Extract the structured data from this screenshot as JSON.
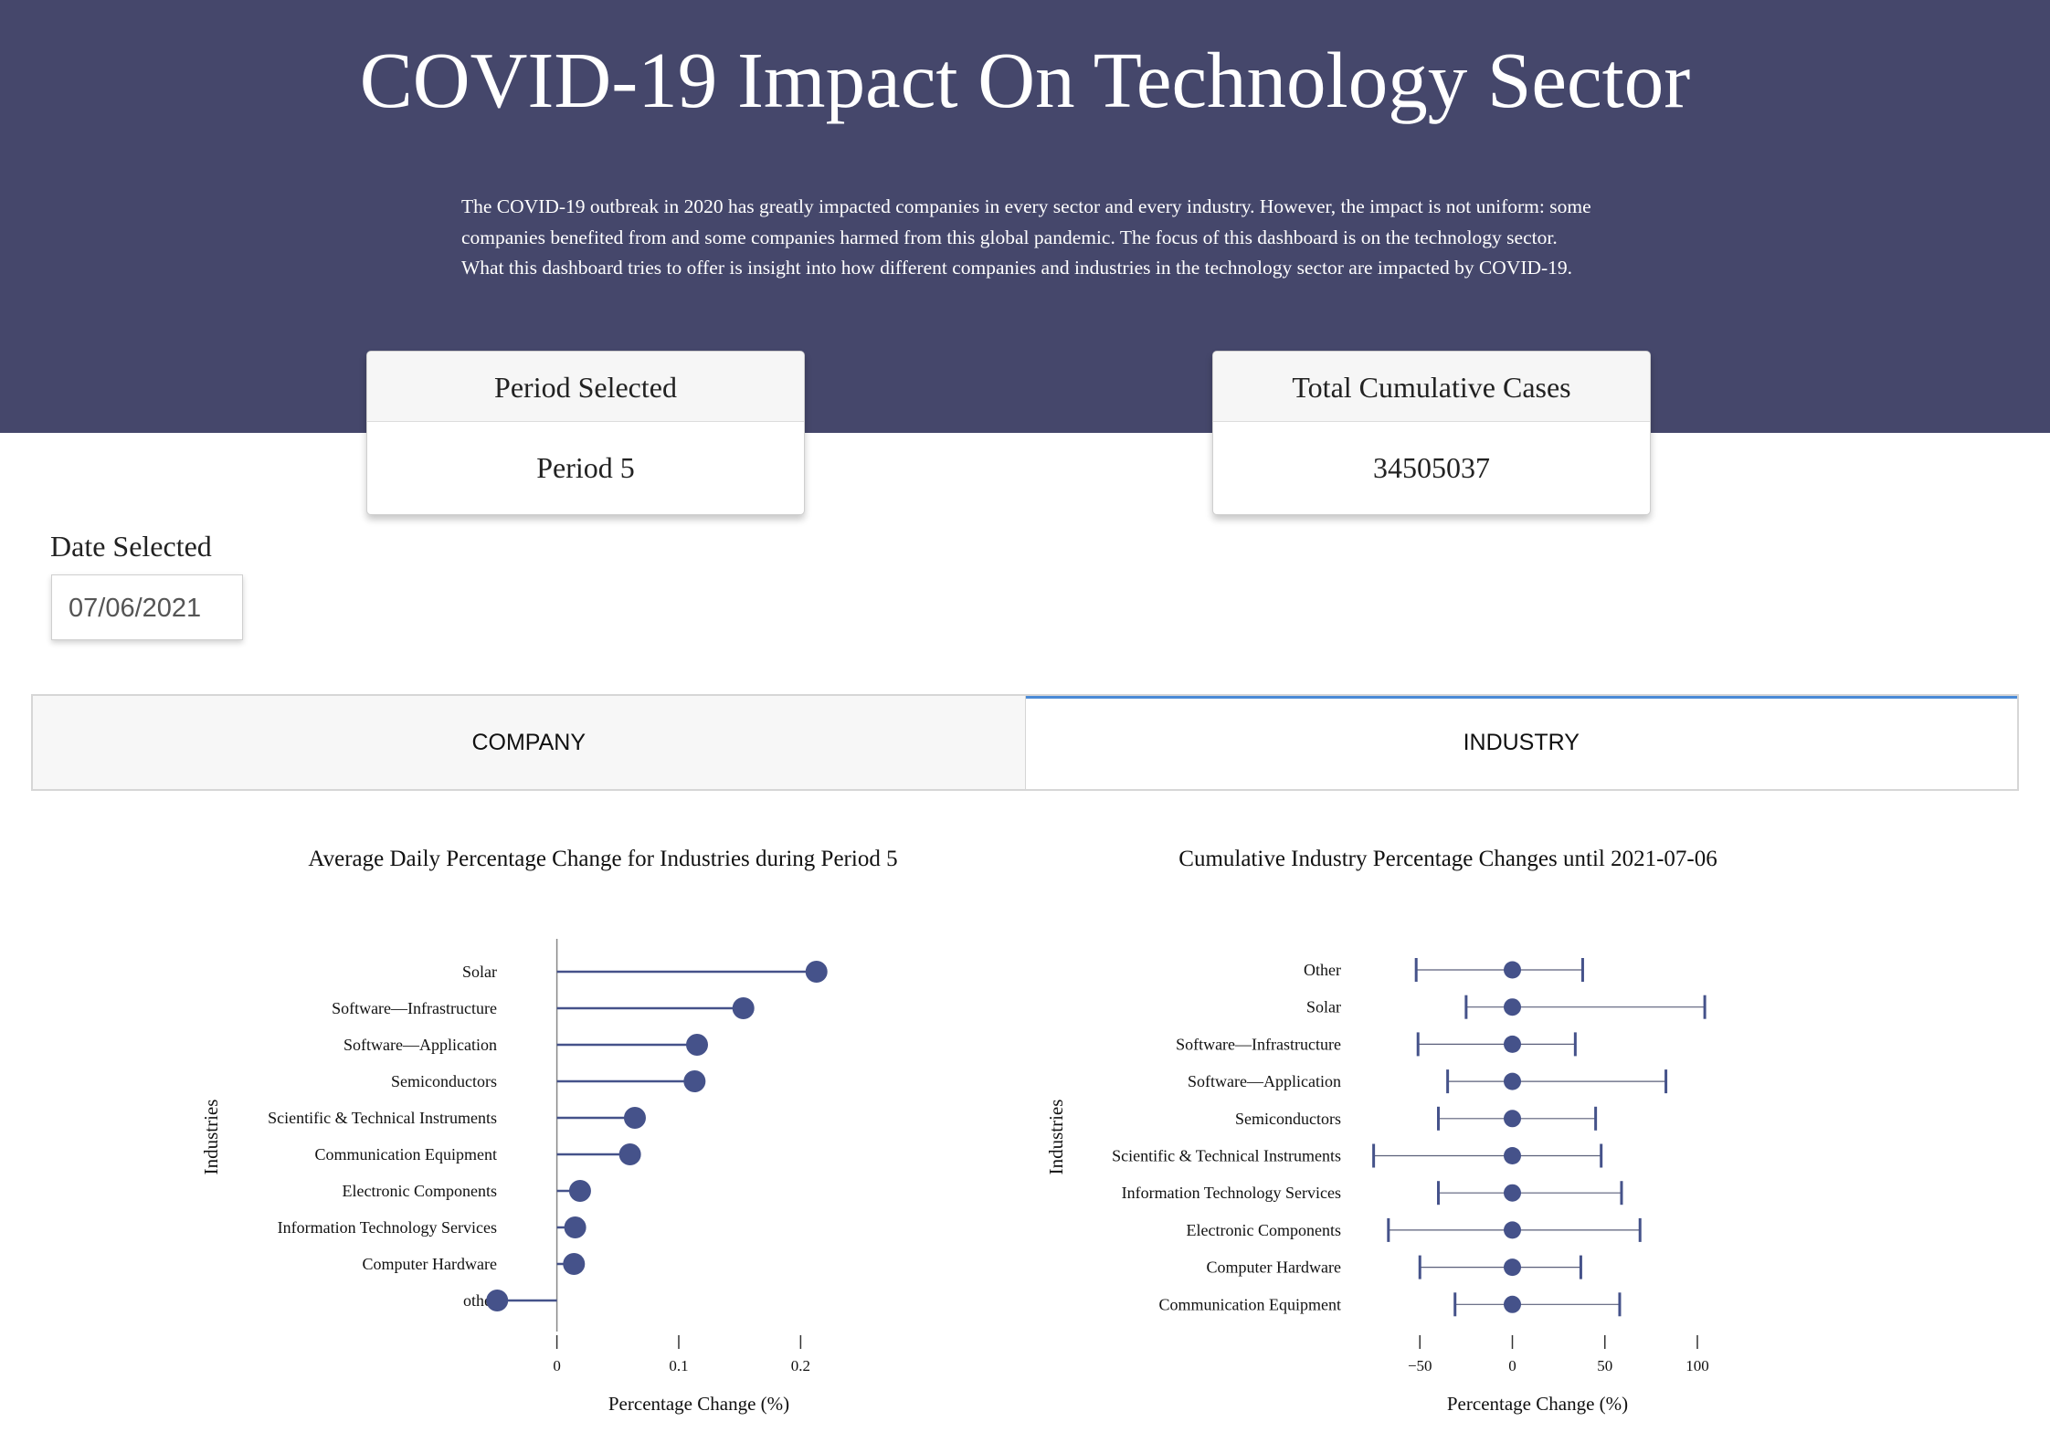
{
  "header": {
    "title": "COVID-19 Impact On Technology Sector",
    "intro": "The COVID-19 outbreak in 2020 has greatly impacted companies in every sector and every industry. However, the impact is not uniform: some companies benefited from and some companies harmed from this global pandemic. The focus of this dashboard is on the technology sector. What this dashboard tries to offer is insight into how different companies and industries in the technology sector are impacted by COVID-19."
  },
  "cards": {
    "period": {
      "label": "Period Selected",
      "value": "Period 5"
    },
    "cases": {
      "label": "Total Cumulative Cases",
      "value": "34505037"
    }
  },
  "date": {
    "label": "Date Selected",
    "value": "07/06/2021"
  },
  "tabs": [
    {
      "label": "COMPANY",
      "active": false
    },
    {
      "label": "INDUSTRY",
      "active": true
    }
  ],
  "colors": {
    "banner": "#45476b",
    "marker": "#45528a",
    "active_tab": "#4a8ad6"
  },
  "chart_data": [
    {
      "type": "lollipop",
      "title": "Average Daily Percentage Change for Industries during Period 5",
      "xlabel": "Percentage Change (%)",
      "ylabel": "Industries",
      "xlim": [
        -0.07,
        0.23
      ],
      "xticks": [
        0,
        0.1,
        0.2
      ],
      "xtick_labels": [
        "0",
        "0.1",
        "0.2"
      ],
      "categories": [
        "Solar",
        "Software—Infrastructure",
        "Software—Application",
        "Semiconductors",
        "Scientific & Technical Instruments",
        "Communication Equipment",
        "Electronic Components",
        "Information Technology Services",
        "Computer Hardware",
        "other"
      ],
      "values": [
        0.213,
        0.153,
        0.115,
        0.113,
        0.064,
        0.06,
        0.019,
        0.015,
        0.014,
        -0.049
      ]
    },
    {
      "type": "errorbar",
      "title": "Cumulative Industry Percentage Changes until 2021-07-06",
      "xlabel": "Percentage Change (%)",
      "ylabel": "Industries",
      "xlim": [
        -80,
        125
      ],
      "xticks": [
        -50,
        0,
        50,
        100
      ],
      "xtick_labels": [
        "−50",
        "0",
        "50",
        "100"
      ],
      "categories": [
        "Other",
        "Solar",
        "Software—Infrastructure",
        "Software—Application",
        "Semiconductors",
        "Scientific & Technical Instruments",
        "Information Technology Services",
        "Electronic Components",
        "Computer Hardware",
        "Communication Equipment"
      ],
      "center": [
        0,
        0,
        0,
        0,
        0,
        0,
        0,
        0,
        0,
        0
      ],
      "low": [
        -52,
        -25,
        -51,
        -35,
        -40,
        -75,
        -40,
        -67,
        -50,
        -31
      ],
      "high": [
        38,
        104,
        34,
        83,
        45,
        48,
        59,
        69,
        37,
        58
      ]
    }
  ]
}
